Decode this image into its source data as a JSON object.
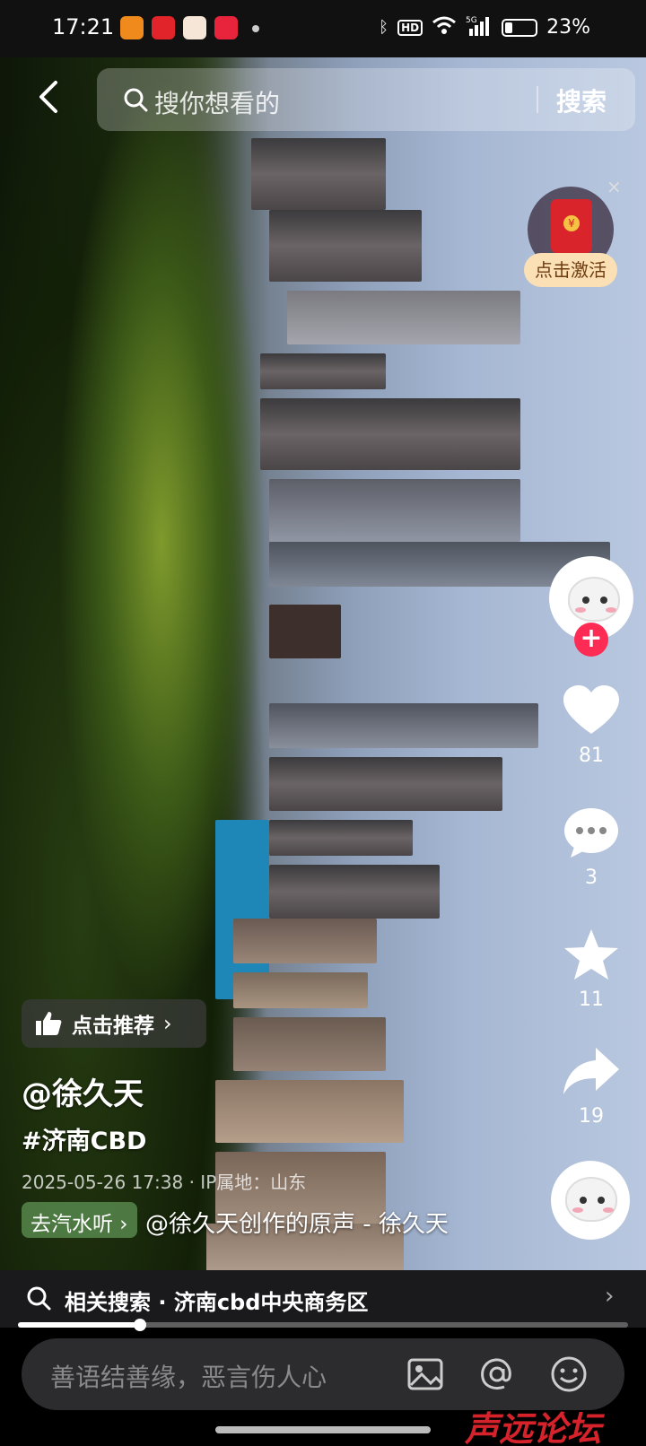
{
  "status_bar": {
    "time": "17:21",
    "network": "5G",
    "battery": "23%"
  },
  "search": {
    "placeholder": "搜你想看的",
    "button": "搜索"
  },
  "red_packet": {
    "label": "点击激活",
    "close": "×"
  },
  "rail": {
    "likes": "81",
    "comments": "3",
    "favorites": "11",
    "shares": "19"
  },
  "post": {
    "recommend_label": "点击推荐",
    "author": "@徐久天",
    "hashtag": "#济南CBD",
    "meta": "2025-05-26 17:38 · IP属地：山东",
    "music_tag": "去汽水听",
    "music_text": "@徐久天创作的原声 - 徐久天"
  },
  "related": {
    "label": "相关搜索 · 济南cbd中央商务区"
  },
  "progress": {
    "fraction": 0.2
  },
  "comment": {
    "placeholder": "善语结善缘，恶言伤人心"
  },
  "watermark": "声远论坛",
  "colors": {
    "accent": "#fe2c55",
    "bg": "#000000"
  }
}
